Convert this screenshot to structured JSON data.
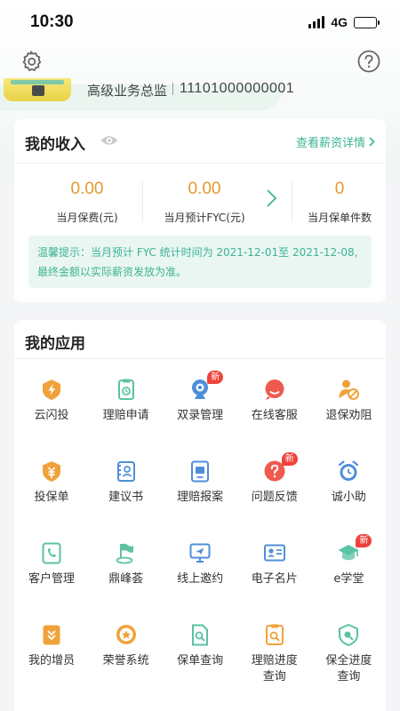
{
  "status": {
    "time": "10:30",
    "network": "4G"
  },
  "profile": {
    "role": "高级业务总监",
    "agent_no": "11101000000001"
  },
  "income": {
    "title": "我的收入",
    "detail_link": "查看薪资详情",
    "stats": [
      {
        "value": "0.00",
        "label": "当月保费(元)"
      },
      {
        "value": "0.00",
        "label": "当月预计FYC(元)"
      },
      {
        "value": "0",
        "label": "当月保单件数"
      }
    ],
    "tip_line1": "温馨提示：当月预计 FYC 统计时间为 2021-12-01至 2021-12-08,",
    "tip_line2": "最终金额以实际薪资发放为准。"
  },
  "apps": {
    "title": "我的应用",
    "new_label": "新",
    "items": [
      {
        "label": "云闪投",
        "icon": "lightning-shield-icon",
        "new": false
      },
      {
        "label": "理赔申请",
        "icon": "claim-apply-icon",
        "new": false
      },
      {
        "label": "双录管理",
        "icon": "webcam-icon",
        "new": true
      },
      {
        "label": "在线客服",
        "icon": "chat-bubble-icon",
        "new": false
      },
      {
        "label": "退保劝阻",
        "icon": "person-block-icon",
        "new": false
      },
      {
        "label": "投保单",
        "icon": "shield-money-icon",
        "new": false
      },
      {
        "label": "建议书",
        "icon": "proposal-book-icon",
        "new": false
      },
      {
        "label": "理赔报案",
        "icon": "claim-report-icon",
        "new": false
      },
      {
        "label": "问题反馈",
        "icon": "question-icon",
        "new": true
      },
      {
        "label": "诚小助",
        "icon": "alarm-clock-icon",
        "new": false
      },
      {
        "label": "客户管理",
        "icon": "phone-contact-icon",
        "new": false
      },
      {
        "label": "鼎峰荟",
        "icon": "flag-icon",
        "new": false
      },
      {
        "label": "线上邀约",
        "icon": "monitor-send-icon",
        "new": false
      },
      {
        "label": "电子名片",
        "icon": "id-card-icon",
        "new": false
      },
      {
        "label": "e学堂",
        "icon": "graduation-cap-icon",
        "new": true
      },
      {
        "label": "我的增员",
        "icon": "recruit-icon",
        "new": false
      },
      {
        "label": "荣誉系统",
        "icon": "medal-icon",
        "new": false
      },
      {
        "label": "保单查询",
        "icon": "policy-search-icon",
        "new": false
      },
      {
        "label": "理赔进度\n查询",
        "icon": "claim-progress-icon",
        "new": false
      },
      {
        "label": "保全进度\n查询",
        "icon": "preservation-progress-icon",
        "new": false
      }
    ]
  },
  "colors": {
    "accent": "#3cb493",
    "amount": "#e29a2e",
    "badge": "#f0423a",
    "icon_orange": "#f0a23a",
    "icon_teal": "#5bc2a4",
    "icon_blue": "#4f8fd8",
    "icon_red": "#ef5a4e"
  }
}
